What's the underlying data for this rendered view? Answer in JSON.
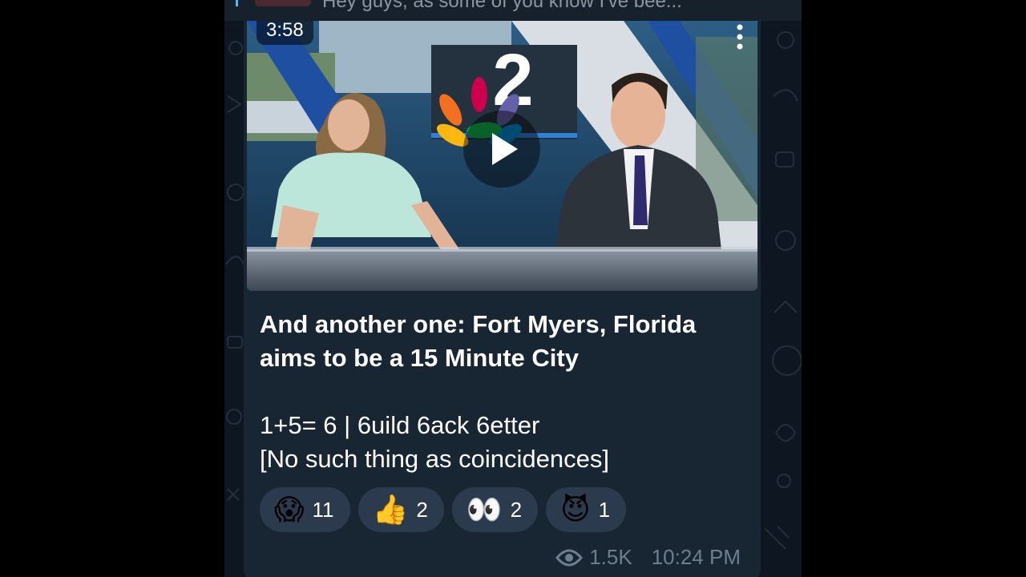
{
  "reply": {
    "preview_text": "Hey guys, as some of you know I've bee..."
  },
  "video": {
    "duration": "3:58",
    "logo_number": "2"
  },
  "caption": {
    "title_line1": "And another one: Fort Myers, Florida",
    "title_line2": "aims to be a 15 Minute City",
    "body_line1": "1+5= 6 | 6uild 6ack 6etter",
    "body_line2": "[No such thing as coincidences]"
  },
  "reactions": [
    {
      "emoji": "😱",
      "icon": "screaming-face-icon",
      "count": "11"
    },
    {
      "emoji": "👍",
      "icon": "thumbs-up-icon",
      "count": "2"
    },
    {
      "emoji": "👀",
      "icon": "eyes-icon",
      "count": "2"
    },
    {
      "emoji": "😈",
      "icon": "smiling-devil-icon",
      "count": "1"
    }
  ],
  "meta": {
    "views": "1.5K",
    "time": "10:24 PM"
  },
  "colors": {
    "background": "#0e1621",
    "bubble": "#182533",
    "reaction_pill": "#2b3b4d",
    "meta_text": "#6d7f8f"
  }
}
